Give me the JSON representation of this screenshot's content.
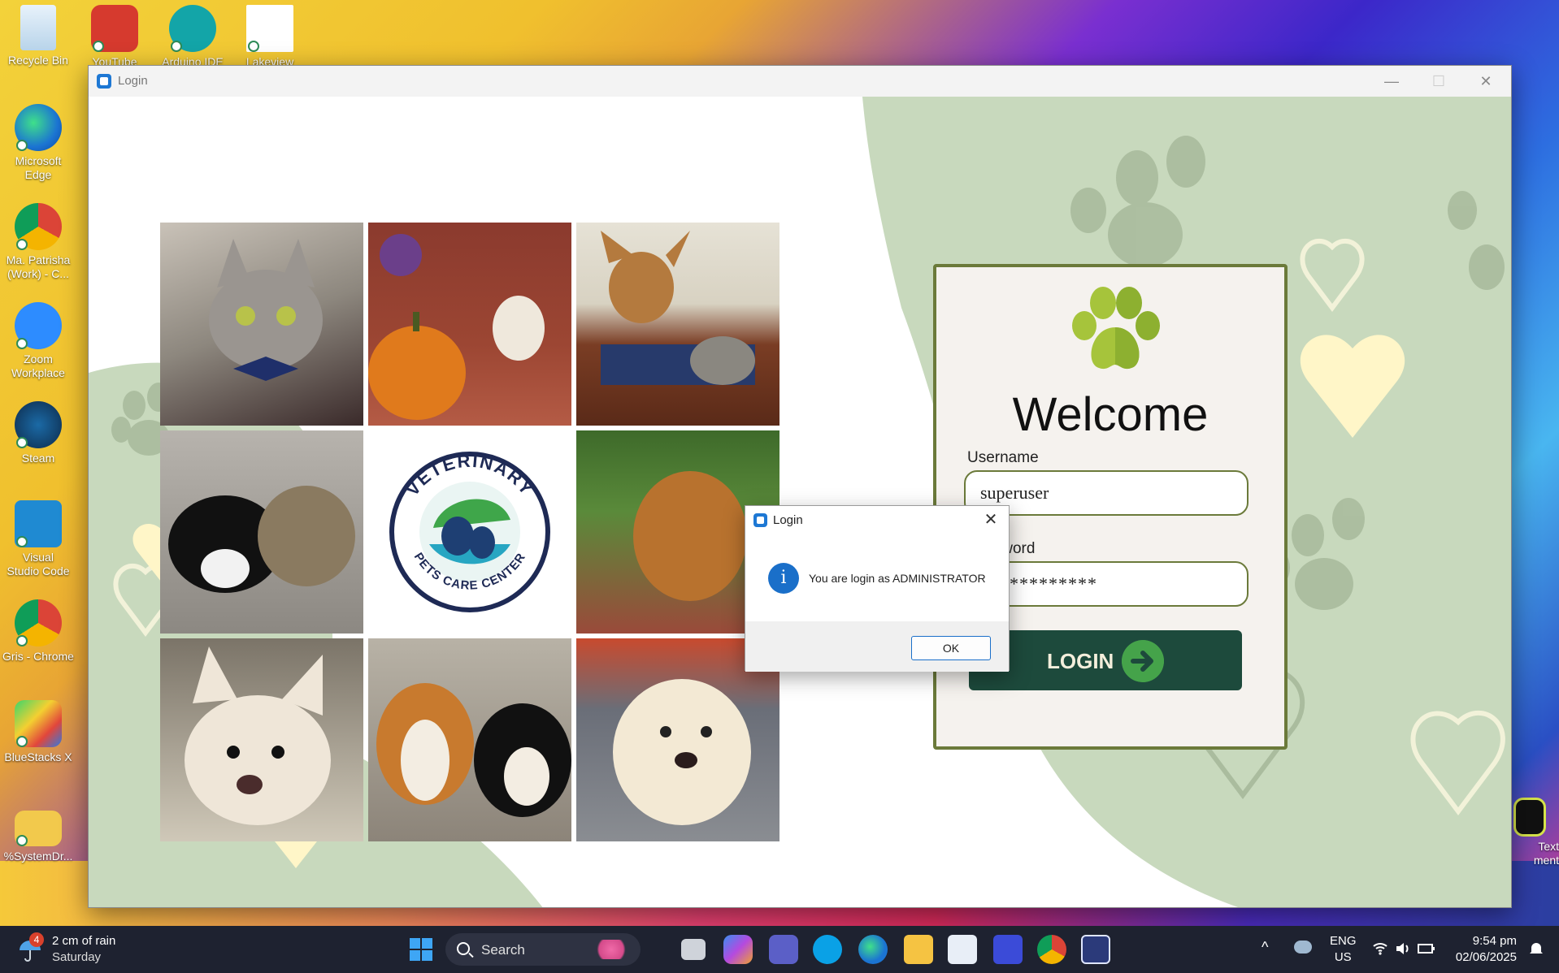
{
  "desktop": {
    "icons": [
      {
        "label": "Recycle Bin"
      },
      {
        "label": "YouTube"
      },
      {
        "label": "Arduino IDE"
      },
      {
        "label": "Lakeview"
      },
      {
        "label": "Microsoft Edge"
      },
      {
        "label": "Ma. Patrisha (Work) - C..."
      },
      {
        "label": "Zoom Workplace"
      },
      {
        "label": "Steam"
      },
      {
        "label": "Visual Studio Code"
      },
      {
        "label": "Gris - Chrome"
      },
      {
        "label": "BlueStacks X"
      },
      {
        "label": "%SystemDr..."
      },
      {
        "label": "Text\nment"
      }
    ]
  },
  "window": {
    "title": "Login",
    "controls": {
      "minimize": "—",
      "maximize": "☐",
      "close": "✕"
    }
  },
  "grid": {
    "logo_line1": "VETERINARY",
    "logo_line2": "PETS CARE CENTER"
  },
  "login_panel": {
    "heading": "Welcome",
    "username_label": "Username",
    "username_value": "superuser",
    "password_label": "Password",
    "password_value": "************",
    "login_button": "LOGIN"
  },
  "dialog": {
    "title": "Login",
    "message": "You are login as ADMINISTRATOR",
    "ok_label": "OK",
    "close": "✕"
  },
  "taskbar": {
    "weather_temp": "2 cm of rain",
    "weather_day": "Saturday",
    "weather_badge": "4",
    "search_placeholder": "Search",
    "lang_line1": "ENG",
    "lang_line2": "US",
    "time": "9:54 pm",
    "date": "02/06/2025"
  },
  "colors": {
    "panel_border": "#6b7a3a",
    "login_button": "#1d4a3c",
    "accent_green": "#45a34a",
    "bg_green": "#c8d9bd"
  }
}
